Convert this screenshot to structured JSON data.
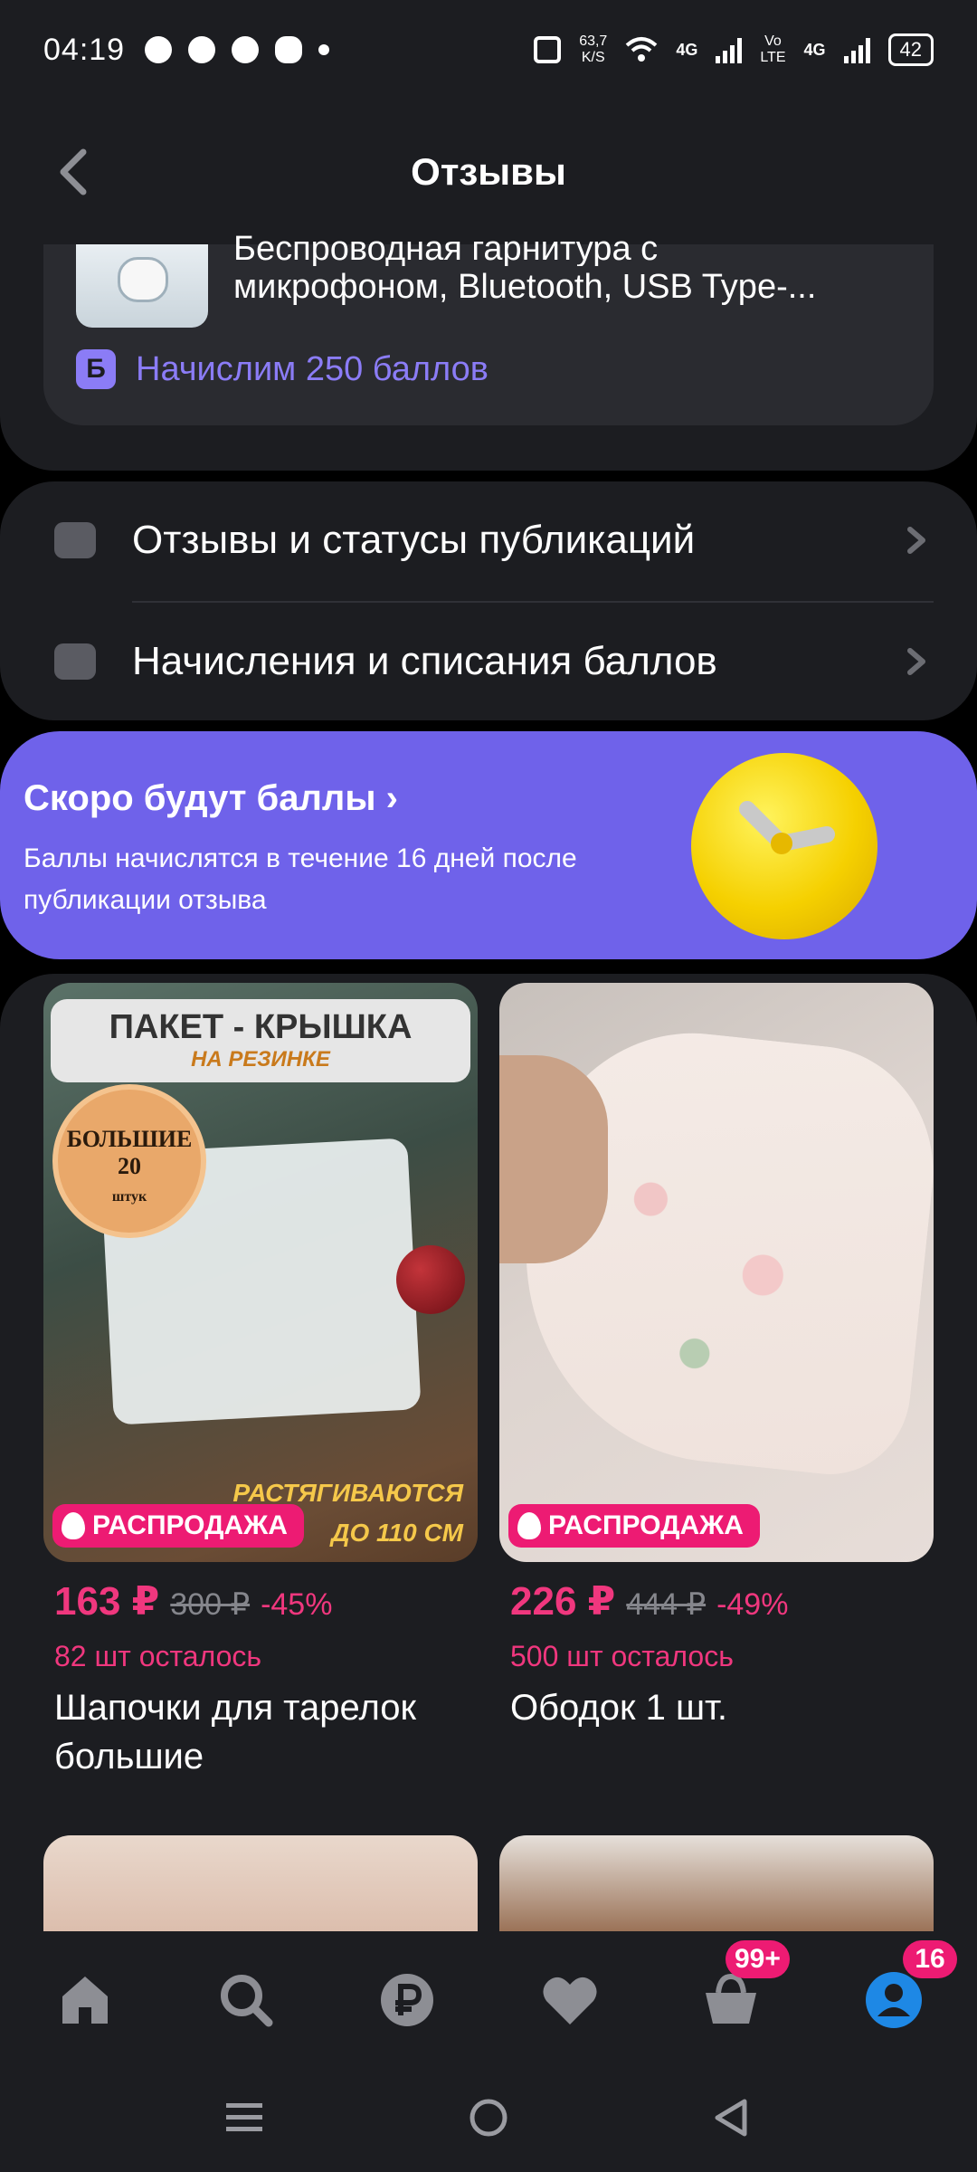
{
  "status_bar": {
    "time": "04:19",
    "speed_value": "63,7",
    "speed_unit": "K/S",
    "net_1": "4G",
    "volte_top": "Vo",
    "volte_bottom": "LTE",
    "net_2": "4G",
    "battery": "42"
  },
  "header": {
    "title": "Отзывы"
  },
  "product": {
    "title_line_1": "Беспроводная гарнитура с",
    "title_line_2": "микрофоном, Bluetooth, USB Type-...",
    "bonus_badge": "Б",
    "bonus_text": "Начислим 250 баллов"
  },
  "menu": {
    "items": [
      {
        "label": "Отзывы и статусы публикаций",
        "icon": "review-icon"
      },
      {
        "label": "Начисления и списания баллов",
        "icon": "wallet-icon"
      }
    ]
  },
  "promo": {
    "title": "Скоро будут баллы",
    "subtitle": "Баллы начислятся в течение 16 дней после публикации отзыва",
    "icon": "clock-icon"
  },
  "feed": {
    "products": [
      {
        "image_banner": "ПАКЕТ - КРЫШКА",
        "image_banner_sub": "НА РЕЗИНКЕ",
        "image_seal_top": "БОЛЬШИЕ",
        "image_seal_num": "20",
        "image_seal_unit": "штук",
        "image_caption_1": "РАСТЯГИВАЮТСЯ",
        "image_caption_2": "ДО 110 СМ",
        "sale_label": "РАСПРОДАЖА",
        "price": "163 ₽",
        "old_price": "300 ₽",
        "discount": "-45%",
        "stock": "82 шт осталось",
        "name": "Шапочки для тарелок большие"
      },
      {
        "sale_label": "РАСПРОДАЖА",
        "price": "226 ₽",
        "old_price": "444 ₽",
        "discount": "-49%",
        "stock": "500 шт осталось",
        "name": "Ободок 1 шт."
      }
    ]
  },
  "bottom_nav": {
    "items": [
      "home-icon",
      "search-icon",
      "ruble-icon",
      "heart-icon",
      "cart-icon",
      "profile-icon"
    ],
    "cart_badge": "99+",
    "profile_badge": "16",
    "active_color": "#1e88e5"
  },
  "colors": {
    "accent_purple": "#6f62ea",
    "sale_pink": "#ed1b73",
    "background": "#1c1d21"
  }
}
